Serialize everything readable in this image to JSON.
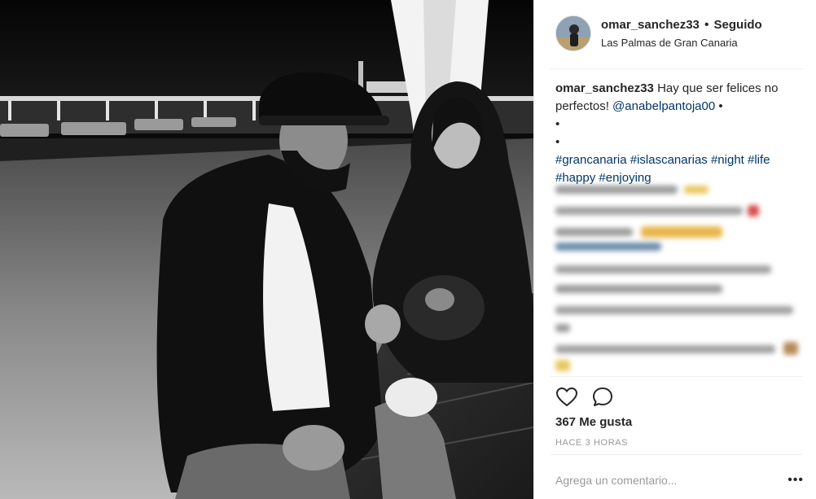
{
  "post": {
    "header": {
      "username": "omar_sanchez33",
      "separator": "•",
      "follow_state": "Seguido",
      "location": "Las Palmas de Gran Canaria"
    },
    "caption": {
      "username": "omar_sanchez33",
      "text": "Hay que ser felices no perfectos!",
      "mention": "@anabelpantoja00",
      "bullets": [
        "•",
        "•",
        "•"
      ],
      "hashtags": [
        "#grancanaria",
        "#islascanarias",
        "#night",
        "#life",
        "#happy",
        "#enjoying"
      ]
    },
    "actions": {
      "like_icon": "heart-icon",
      "comment_icon": "comment-bubble-icon"
    },
    "likes_text": "367 Me gusta",
    "time_text": "HACE 3 HORAS",
    "comment_input": {
      "placeholder": "Agrega un comentario...",
      "more_icon": "more-options-icon",
      "more_glyph": "•••"
    },
    "colors": {
      "link": "#003569",
      "muted": "#999999",
      "text": "#262626",
      "border": "#efefef"
    }
  }
}
